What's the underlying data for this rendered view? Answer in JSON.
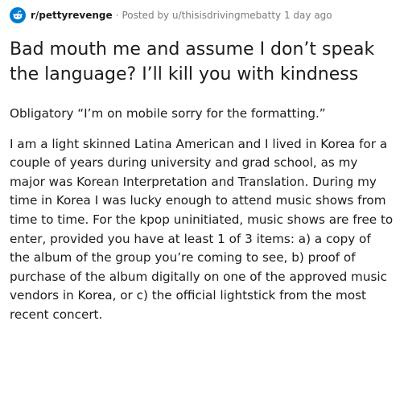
{
  "post": {
    "subreddit": "r/pettyrevenge",
    "separator": "·",
    "posted_by_prefix": "Posted by ",
    "username": "u/thisisdrivingmebatty",
    "time_ago": "1 day ago",
    "title": "Bad mouth me and assume I don’t speak the language? I’ll kill you with kindness",
    "paragraphs": [
      "Obligatory “I’m on mobile sorry for the formatting.”",
      "I am a light skinned Latina American and I lived in Korea for a couple of years during university and grad school, as my major was Korean Interpretation and Translation. During my time in Korea I was lucky enough to attend music shows from time to time. For the kpop uninitiated, music shows are free to enter, provided you have at least 1 of 3 items: a) a copy of the album of the group you’re coming to see, b) proof of purchase of the album digitally on one of the approved music vendors in Korea, or c) the official lightstick from the most recent concert."
    ]
  },
  "colors": {
    "accent": "#0079d3",
    "text": "#1c1c1c",
    "meta": "#7c7c7c"
  },
  "icons": {
    "subreddit_icon": "reddit-snoo-icon"
  }
}
